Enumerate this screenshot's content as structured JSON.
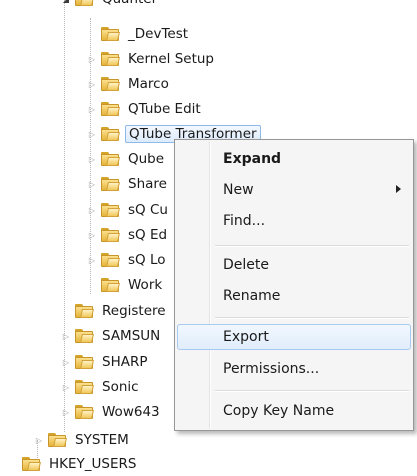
{
  "tree": {
    "parent_label": "Quantel",
    "items": [
      {
        "label": "_DevTest"
      },
      {
        "label": "Kernel Setup"
      },
      {
        "label": "Marco"
      },
      {
        "label": "QTube Edit"
      },
      {
        "label": "QTube Transformer"
      },
      {
        "label": "Qube"
      },
      {
        "label": "Share"
      },
      {
        "label": "sQ Cu"
      },
      {
        "label": "sQ Ed"
      },
      {
        "label": "sQ Lo"
      },
      {
        "label": "Work"
      }
    ],
    "siblings": [
      {
        "label": "Registere"
      },
      {
        "label": "SAMSUN"
      },
      {
        "label": "SHARP"
      },
      {
        "label": "Sonic"
      },
      {
        "label": "Wow643"
      }
    ],
    "system_label": "SYSTEM",
    "bottom_label": "HKEY_USERS"
  },
  "context_menu": {
    "items": [
      {
        "label": "Expand"
      },
      {
        "label": "New"
      },
      {
        "label": "Find..."
      },
      {
        "label": "Delete"
      },
      {
        "label": "Rename"
      },
      {
        "label": "Export"
      },
      {
        "label": "Permissions..."
      },
      {
        "label": "Copy Key Name"
      }
    ]
  },
  "colors": {
    "selection_border": "#8fb9e6",
    "menu_background": "#f5f5f5",
    "folder_yellow": "#e5b43b"
  }
}
